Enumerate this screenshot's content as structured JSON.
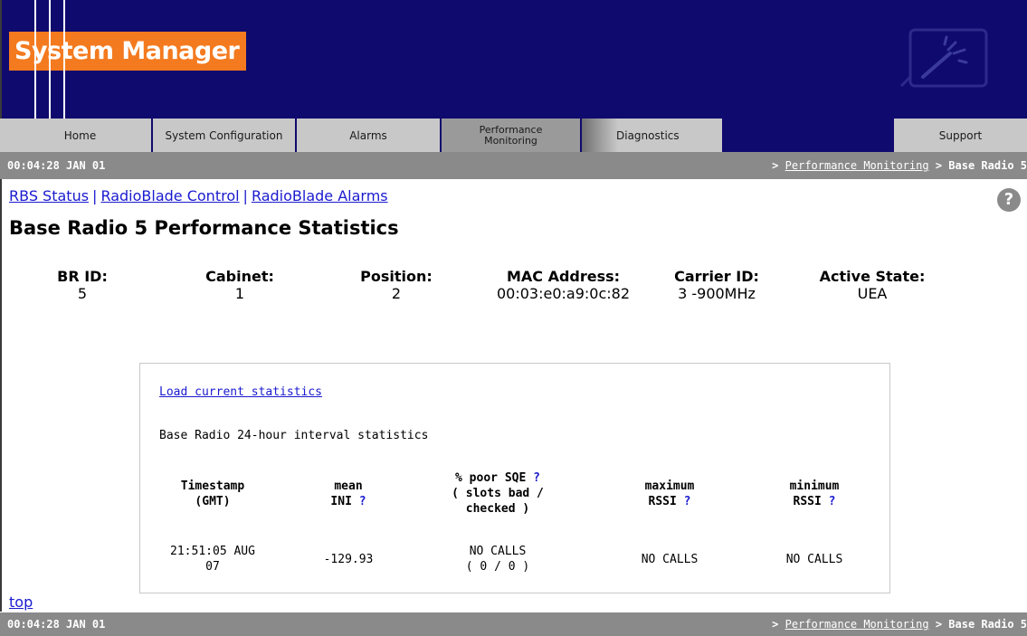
{
  "header": {
    "app_title": "System Manager"
  },
  "nav": {
    "tabs": [
      {
        "label": "Home"
      },
      {
        "label": "System Configuration"
      },
      {
        "label": "Alarms"
      },
      {
        "label": "Performance Monitoring",
        "line1": "Performance",
        "line2": "Monitoring",
        "active": true
      },
      {
        "label": "Diagnostics"
      },
      {
        "label": "Support"
      }
    ]
  },
  "status": {
    "time": "00:04:28 JAN 01",
    "crumb_prefix": ">",
    "crumb_link": "Performance Monitoring",
    "crumb_sep": ">",
    "crumb_current": "Base Radio 5"
  },
  "sublinks": [
    {
      "label": "RBS Status"
    },
    {
      "label": "RadioBlade Control"
    },
    {
      "label": "RadioBlade Alarms"
    }
  ],
  "sublink_separator": "|",
  "help_glyph": "?",
  "page_title": "Base Radio 5 Performance Statistics",
  "info": {
    "br_id": {
      "label": "BR ID:",
      "value": "5"
    },
    "cabinet": {
      "label": "Cabinet:",
      "value": "1"
    },
    "position": {
      "label": "Position:",
      "value": "2"
    },
    "mac": {
      "label": "MAC Address:",
      "value": "00:03:e0:a9:0c:82"
    },
    "carrier": {
      "label": "Carrier ID:",
      "value": "3 -900MHz"
    },
    "state": {
      "label": "Active State:",
      "value": "UEA"
    }
  },
  "stats": {
    "load_link": "Load current statistics",
    "interval_title": "Base Radio 24-hour interval statistics",
    "help_mark": "?",
    "columns": {
      "timestamp": {
        "line1": "Timestamp",
        "line2": "(GMT)"
      },
      "mean_ini": {
        "line1": "mean",
        "line2": "INI"
      },
      "poor_sqe": {
        "line1": "% poor SQE",
        "line2": "( slots bad /",
        "line3": "checked )"
      },
      "max_rssi": {
        "line1": "maximum",
        "line2": "RSSI"
      },
      "min_rssi": {
        "line1": "minimum",
        "line2": "RSSI"
      }
    },
    "row": {
      "timestamp_line1": "21:51:05 AUG",
      "timestamp_line2": "07",
      "mean_ini": "-129.93",
      "poor_sqe_line1": "NO CALLS",
      "poor_sqe_line2": "( 0 / 0 )",
      "max_rssi": "NO CALLS",
      "min_rssi": "NO CALLS"
    }
  },
  "top_link": "top",
  "colors": {
    "header_bg": "#0f0a6e",
    "logo_bg": "#f47a1f",
    "tab_bg": "#c8c8c8",
    "tab_active_bg": "#9a9a9a",
    "statusbar_bg": "#8a8a8a",
    "link": "#1a1ad0"
  }
}
